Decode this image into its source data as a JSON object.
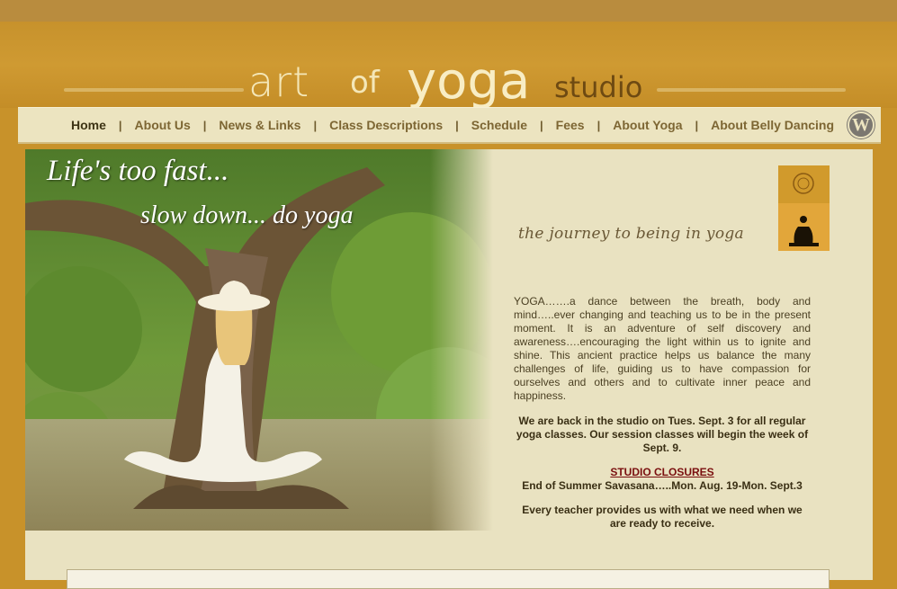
{
  "header": {
    "logo_art": "art",
    "logo_of": "of",
    "logo_yoga": "yoga",
    "logo_studio": "studio"
  },
  "nav": {
    "items": [
      {
        "label": "Home"
      },
      {
        "label": "About Us"
      },
      {
        "label": "News & Links"
      },
      {
        "label": "Class Descriptions"
      },
      {
        "label": "Schedule"
      },
      {
        "label": "Fees"
      },
      {
        "label": "About Yoga"
      },
      {
        "label": "About Belly Dancing"
      }
    ],
    "separator": "|",
    "wordpress_icon": "wordpress-icon"
  },
  "hero": {
    "quote_line1": "Life's too fast...",
    "quote_line2": "slow down... do yoga"
  },
  "main": {
    "tagline": "the journey to being in yoga",
    "about_text": "YOGA…….a dance between the breath, body and mind…..ever changing and teaching us to be in the present moment. It is an adventure of self discovery and awareness….encouraging the light within us to ignite and shine. This ancient practice helps us balance the many challenges of life, guiding us to have compassion for ourselves and others and to cultivate inner peace and happiness.",
    "notice": "We are back in the studio on Tues. Sept. 3 for all regular yoga classes.  Our session classes will begin the week of Sept. 9.",
    "closures_title": "STUDIO CLOSURES",
    "closures_item": "End of Summer Savasana…..Mon. Aug. 19-Mon. Sept.3",
    "teacher_quote": "Every teacher provides us with what we need when we are ready to receive."
  },
  "colors": {
    "background": "#c8922a",
    "nav_bg": "#ece4c0",
    "content_bg": "#e9e2c1",
    "closures_red": "#7a0f0f"
  }
}
